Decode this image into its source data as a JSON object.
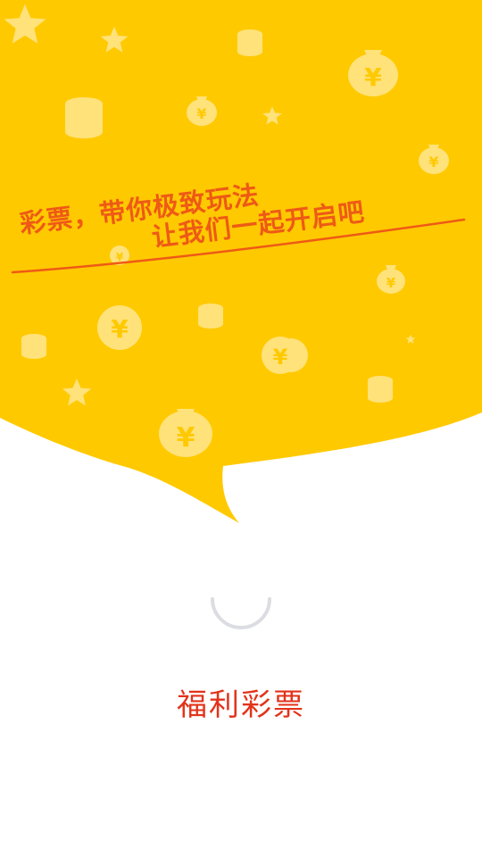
{
  "splash": {
    "slogan_line1": "彩票，带你极致玩法",
    "slogan_line2": "让我们一起开启吧",
    "background_color": "#ffc900",
    "decor_color": "#ffe27a",
    "decor_icons": [
      "star-icon",
      "coin-stack-icon",
      "money-bag-icon",
      "yuan-coin-icon"
    ],
    "currency_symbol": "¥"
  },
  "loading": {
    "indicator": "spinner-icon",
    "color": "#dcdde2"
  },
  "app": {
    "name": "福利彩票",
    "name_color": "#e2331a"
  }
}
